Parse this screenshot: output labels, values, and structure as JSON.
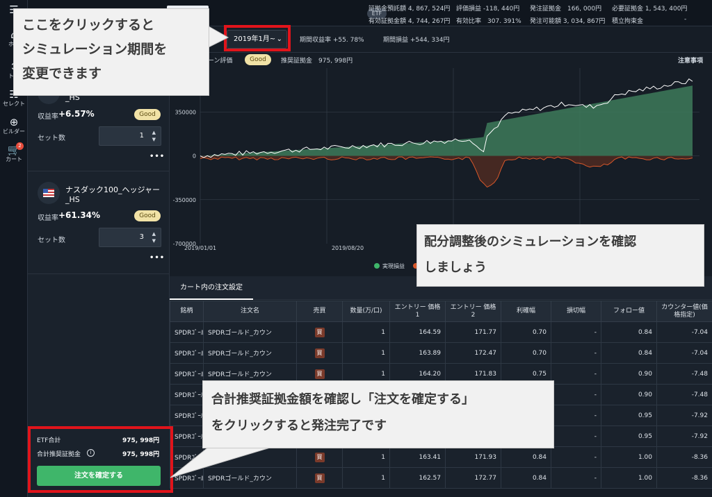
{
  "rail": {
    "items": [
      {
        "icon": "menu-icon",
        "glyph": "☰",
        "label": ""
      },
      {
        "icon": "home-icon",
        "glyph": "⌂",
        "label": "ホー"
      },
      {
        "icon": "trade-icon",
        "glyph": "↕",
        "label": "トレ"
      },
      {
        "icon": "select-icon",
        "glyph": "☷",
        "label": "セレクト"
      },
      {
        "icon": "builder-icon",
        "glyph": "⊕",
        "label": "ビルダー"
      },
      {
        "icon": "cart-icon",
        "glyph": "🛒",
        "label": "カート",
        "badge": "2"
      }
    ]
  },
  "topbar": {
    "etf": "ETF",
    "row1": [
      {
        "label": "証拠金預託額",
        "value": "4, 867, 524円"
      },
      {
        "label": "評価損益",
        "value": "-118, 440円"
      },
      {
        "label": "発注証拠金",
        "value": "166, 000円"
      },
      {
        "label": "必要証拠金",
        "value": "1, 543, 400円"
      }
    ],
    "row2": [
      {
        "label": "有効証拠金額",
        "value": "4, 744, 267円"
      },
      {
        "label": "有効比率",
        "value": "307. 391%"
      },
      {
        "label": "発注可能額",
        "value": "3, 034, 867円"
      },
      {
        "label": "積立拘束金",
        "value": "-"
      }
    ]
  },
  "bar2": {
    "period": "2019年1月~",
    "return_label": "期間収益率",
    "return_value": "+55. 78%",
    "pl_label": "期間損益",
    "pl_value": "+544, 334円"
  },
  "chart_head": {
    "eval_label": "ターン評価",
    "eval_badge": "Good",
    "margin_label": "推奨証拠金",
    "margin_value": "975, 998円",
    "notes": "注意事項"
  },
  "cards": [
    {
      "name": "_HS",
      "rate_label": "収益率",
      "rate": "+6.57%",
      "badge": "Good",
      "set_label": "セット数",
      "sets": "1",
      "menu": "•••"
    },
    {
      "name": "ナスダック100_ヘッジャー\n_HS",
      "name1": "ナスダック100_ヘッジャー",
      "name2": "_HS",
      "rate_label": "収益率",
      "rate": "+61.34%",
      "badge": "Good",
      "set_label": "セット数",
      "sets": "3",
      "menu": "•••"
    }
  ],
  "chart_data": {
    "type": "area",
    "x_ticks": [
      "2019/01/01",
      "2019/08/20"
    ],
    "y_ticks": [
      "350000",
      "0",
      "-350000",
      "-700000"
    ],
    "ylim": [
      -700000,
      700000
    ],
    "series": [
      {
        "name": "実現損益",
        "color": "#3d7a5a"
      },
      {
        "name": "",
        "color": "#d9582b"
      }
    ],
    "legend": [
      "実現損益"
    ]
  },
  "orders": {
    "tab": "カート内の注文設定",
    "columns": [
      "銘柄",
      "注文名",
      "売買",
      "数量(万/口)",
      "エントリー 価格\n1",
      "エントリー 価格\n2",
      "利確幅",
      "損切幅",
      "フォロー値",
      "カウンター値(価\n格指定)"
    ],
    "rows": [
      [
        "SPDRｺﾞｰﾙﾄﾞ",
        "SPDRゴールド_カウン",
        "買",
        "1",
        "164.59",
        "171.77",
        "0.70",
        "-",
        "0.84",
        "-7.04"
      ],
      [
        "SPDRｺﾞｰﾙﾄﾞ",
        "SPDRゴールド_カウン",
        "買",
        "1",
        "163.89",
        "172.47",
        "0.70",
        "-",
        "0.84",
        "-7.04"
      ],
      [
        "SPDRｺﾞｰﾙﾄﾞ",
        "SPDRゴールド_カウン",
        "買",
        "1",
        "164.20",
        "171.83",
        "0.75",
        "-",
        "0.90",
        "-7.48"
      ],
      [
        "SPDRｺﾞｰﾙﾄﾞ",
        "",
        "",
        "",
        "",
        "",
        "",
        "-",
        "0.90",
        "-7.48"
      ],
      [
        "SPDRｺﾞｰﾙﾄﾞ",
        "",
        "",
        "",
        "",
        "",
        "",
        "-",
        "0.95",
        "-7.92"
      ],
      [
        "SPDRｺﾞｰﾙﾄﾞ",
        "",
        "",
        "",
        "",
        "",
        "",
        "-",
        "0.95",
        "-7.92"
      ],
      [
        "SPDRｺﾞｰﾙﾄﾞ",
        "SPDRゴ",
        "買",
        "1",
        "163.41",
        "171.93",
        "0.84",
        "-",
        "1.00",
        "-8.36"
      ],
      [
        "SPDRｺﾞｰﾙﾄﾞ",
        "SPDRゴールド_カウン",
        "買",
        "1",
        "162.57",
        "172.77",
        "0.84",
        "-",
        "1.00",
        "-8.36"
      ]
    ]
  },
  "summary": {
    "etf_label": "ETF合計",
    "etf_value": "975, 998円",
    "margin_label": "合計推奨証拠金",
    "margin_value": "975, 998円",
    "confirm": "注文を確定する"
  },
  "callouts": {
    "c1": [
      "ここをクリックすると",
      "シミュレーション期間を",
      "変更できます"
    ],
    "c2": [
      "配分調整後のシミュレーションを確認",
      "しましょう"
    ],
    "c3": [
      "合計推奨証拠金額を確認し「注文を確定する」",
      "をクリックすると発注完了です"
    ]
  }
}
